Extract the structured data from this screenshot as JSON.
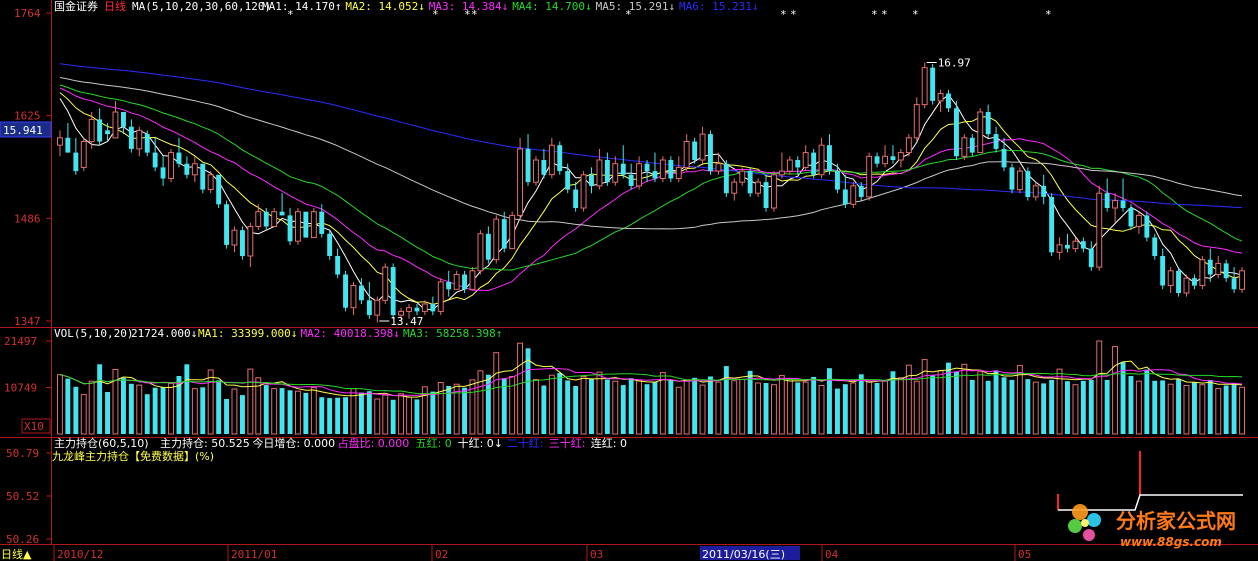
{
  "colors": {
    "background": "#000000",
    "frame": "#b01818",
    "axis_text": "#d23030",
    "up": "#e46d6d",
    "down": "#43e6f0",
    "white": "#ffffff",
    "yellow": "#ffff4c",
    "magenta": "#ff2aff",
    "green": "#27d827",
    "gray": "#c8c8c8",
    "blue": "#2c2cff"
  },
  "header": {
    "stock_name": "国金证券",
    "period": "日线",
    "ma_label": "MA(5,10,20,30,60,120)",
    "ma": [
      {
        "label": "MA1:",
        "value": "14.170",
        "dir": "↑"
      },
      {
        "label": "MA2:",
        "value": "14.052",
        "dir": "↓"
      },
      {
        "label": "MA3:",
        "value": "14.384",
        "dir": "↓"
      },
      {
        "label": "MA4:",
        "value": "14.700",
        "dir": "↓"
      },
      {
        "label": "MA5:",
        "value": "15.291",
        "dir": "↓"
      },
      {
        "label": "MA6:",
        "value": "15.231",
        "dir": "↓"
      }
    ]
  },
  "vol_header": {
    "label": "VOL(5,10,20)",
    "value": "21724.000",
    "dir": "↓",
    "ma": [
      {
        "label": "MA1:",
        "value": "33399.000",
        "dir": "↓"
      },
      {
        "label": "MA2:",
        "value": "40018.398",
        "dir": "↓"
      },
      {
        "label": "MA3:",
        "value": "58258.398",
        "dir": "↑"
      }
    ]
  },
  "ind_header": {
    "label": "主力持仓(60,5,10)",
    "items": [
      {
        "label": "主力持仓:",
        "value": "50.525"
      },
      {
        "label": "今日增仓:",
        "value": "0.000"
      },
      {
        "label": "占盘比:",
        "value": "0.000"
      },
      {
        "label": "五红:",
        "value": "0"
      },
      {
        "label": "十红:",
        "value": "0↓"
      },
      {
        "label": "二十红:",
        "value": ""
      },
      {
        "label": "三十红:",
        "value": ""
      },
      {
        "label": "连红:",
        "value": "0"
      }
    ],
    "subtitle": "九龙峰主力持仓【免费数据】(%)"
  },
  "price_axis": {
    "ticks": [
      "1764",
      "1625",
      "1486",
      "1347"
    ],
    "current": "15.941"
  },
  "vol_axis": {
    "ticks": [
      "21497",
      "10749"
    ],
    "unit": "X10"
  },
  "ind_axis": {
    "ticks": [
      "50.79",
      "50.52",
      "50.26"
    ]
  },
  "date_axis": {
    "period_button": "日线▲",
    "labels": [
      "2010/12",
      "2011/01",
      "02",
      "03",
      "2011/03/16(三)",
      "04",
      "05"
    ]
  },
  "watermark": {
    "text": "分析家公式网",
    "url": "www.88gs.com"
  },
  "chart_data": {
    "type": "candlestick",
    "title": "国金证券 日线",
    "ylim": [
      13.47,
      17.64
    ],
    "annotations": [
      {
        "text": "16.97",
        "type": "high",
        "value": 16.97
      },
      {
        "text": "13.47",
        "type": "low",
        "value": 13.47
      }
    ],
    "candles": [
      [
        15.85,
        16.05,
        15.7,
        15.95
      ],
      [
        15.95,
        16.15,
        15.75,
        15.75
      ],
      [
        15.75,
        15.95,
        15.45,
        15.5
      ],
      [
        15.55,
        15.95,
        15.5,
        15.9
      ],
      [
        15.9,
        16.3,
        15.8,
        16.2
      ],
      [
        16.2,
        16.35,
        15.85,
        15.9
      ],
      [
        16.05,
        16.15,
        15.9,
        16.0
      ],
      [
        15.95,
        16.45,
        15.95,
        16.3
      ],
      [
        16.3,
        16.3,
        16.0,
        16.1
      ],
      [
        16.1,
        16.2,
        15.75,
        15.8
      ],
      [
        15.8,
        16.1,
        15.7,
        16.05
      ],
      [
        16.0,
        16.05,
        15.7,
        15.75
      ],
      [
        15.75,
        15.95,
        15.5,
        15.55
      ],
      [
        15.55,
        15.7,
        15.3,
        15.4
      ],
      [
        15.4,
        15.8,
        15.35,
        15.75
      ],
      [
        15.75,
        15.95,
        15.55,
        15.6
      ],
      [
        15.6,
        15.7,
        15.4,
        15.45
      ],
      [
        15.45,
        15.7,
        15.35,
        15.6
      ],
      [
        15.6,
        15.6,
        15.2,
        15.25
      ],
      [
        15.25,
        15.5,
        15.2,
        15.45
      ],
      [
        15.45,
        15.45,
        15.0,
        15.05
      ],
      [
        15.05,
        15.1,
        14.45,
        14.5
      ],
      [
        14.5,
        14.75,
        14.4,
        14.7
      ],
      [
        14.7,
        14.75,
        14.3,
        14.35
      ],
      [
        14.35,
        14.8,
        14.2,
        14.75
      ],
      [
        14.75,
        15.05,
        14.7,
        14.95
      ],
      [
        14.95,
        15.0,
        14.7,
        14.75
      ],
      [
        14.75,
        15.0,
        14.75,
        14.95
      ],
      [
        14.95,
        15.2,
        14.9,
        14.9
      ],
      [
        14.9,
        15.0,
        14.5,
        14.55
      ],
      [
        14.55,
        15.0,
        14.5,
        14.95
      ],
      [
        14.95,
        14.95,
        14.6,
        14.6
      ],
      [
        14.6,
        15.0,
        14.6,
        14.95
      ],
      [
        14.95,
        15.05,
        14.6,
        14.65
      ],
      [
        14.65,
        14.7,
        14.3,
        14.35
      ],
      [
        14.35,
        14.45,
        14.05,
        14.1
      ],
      [
        14.1,
        14.15,
        13.6,
        13.65
      ],
      [
        13.65,
        14.0,
        13.55,
        13.95
      ],
      [
        13.95,
        14.05,
        13.7,
        13.75
      ],
      [
        13.75,
        14.0,
        13.5,
        13.55
      ],
      [
        13.55,
        13.8,
        13.45,
        13.75
      ],
      [
        13.75,
        14.25,
        13.7,
        14.2
      ],
      [
        14.2,
        14.25,
        13.5,
        13.55
      ],
      [
        13.55,
        13.65,
        13.47,
        13.6
      ],
      [
        13.6,
        13.7,
        13.5,
        13.65
      ],
      [
        13.65,
        13.7,
        13.55,
        13.6
      ],
      [
        13.6,
        13.75,
        13.55,
        13.7
      ],
      [
        13.7,
        13.8,
        13.55,
        13.6
      ],
      [
        13.6,
        14.05,
        13.55,
        14.0
      ],
      [
        14.0,
        14.15,
        13.8,
        13.9
      ],
      [
        13.9,
        14.15,
        13.9,
        14.1
      ],
      [
        14.1,
        14.15,
        13.85,
        13.9
      ],
      [
        13.9,
        14.2,
        13.9,
        14.15
      ],
      [
        14.15,
        14.7,
        14.1,
        14.65
      ],
      [
        14.65,
        14.75,
        14.25,
        14.3
      ],
      [
        14.3,
        14.9,
        14.25,
        14.85
      ],
      [
        14.85,
        14.95,
        14.4,
        14.45
      ],
      [
        14.45,
        14.95,
        14.45,
        14.9
      ],
      [
        14.9,
        15.95,
        14.85,
        15.8
      ],
      [
        15.8,
        16.0,
        15.3,
        15.35
      ],
      [
        15.35,
        15.7,
        15.3,
        15.65
      ],
      [
        15.65,
        15.8,
        15.4,
        15.45
      ],
      [
        15.45,
        15.95,
        15.4,
        15.85
      ],
      [
        15.85,
        15.9,
        15.45,
        15.5
      ],
      [
        15.5,
        15.6,
        15.2,
        15.25
      ],
      [
        15.25,
        15.35,
        14.95,
        15.0
      ],
      [
        15.0,
        15.5,
        14.95,
        15.45
      ],
      [
        15.45,
        15.55,
        15.2,
        15.3
      ],
      [
        15.3,
        15.8,
        15.25,
        15.65
      ],
      [
        15.65,
        15.75,
        15.3,
        15.35
      ],
      [
        15.35,
        15.7,
        15.3,
        15.6
      ],
      [
        15.6,
        15.85,
        15.4,
        15.45
      ],
      [
        15.45,
        15.6,
        15.25,
        15.3
      ],
      [
        15.3,
        15.7,
        15.25,
        15.6
      ],
      [
        15.6,
        15.65,
        15.35,
        15.5
      ],
      [
        15.5,
        15.75,
        15.35,
        15.4
      ],
      [
        15.4,
        15.7,
        15.35,
        15.65
      ],
      [
        15.65,
        15.7,
        15.35,
        15.4
      ],
      [
        15.4,
        15.7,
        15.35,
        15.55
      ],
      [
        15.55,
        16.0,
        15.5,
        15.9
      ],
      [
        15.9,
        15.95,
        15.6,
        15.65
      ],
      [
        15.65,
        16.1,
        15.6,
        16.0
      ],
      [
        16.0,
        16.05,
        15.45,
        15.5
      ],
      [
        15.5,
        15.75,
        15.45,
        15.6
      ],
      [
        15.6,
        15.65,
        15.15,
        15.2
      ],
      [
        15.2,
        15.4,
        15.1,
        15.35
      ],
      [
        15.35,
        15.55,
        15.3,
        15.5
      ],
      [
        15.5,
        15.55,
        15.15,
        15.2
      ],
      [
        15.2,
        15.4,
        15.15,
        15.35
      ],
      [
        15.35,
        15.45,
        14.95,
        15.0
      ],
      [
        15.0,
        15.5,
        14.95,
        15.45
      ],
      [
        15.45,
        15.75,
        15.4,
        15.5
      ],
      [
        15.5,
        15.7,
        15.45,
        15.65
      ],
      [
        15.65,
        15.7,
        15.45,
        15.55
      ],
      [
        15.55,
        15.85,
        15.5,
        15.75
      ],
      [
        15.75,
        15.8,
        15.4,
        15.45
      ],
      [
        15.45,
        15.95,
        15.4,
        15.85
      ],
      [
        15.85,
        16.0,
        15.45,
        15.5
      ],
      [
        15.5,
        15.6,
        15.2,
        15.25
      ],
      [
        15.25,
        15.45,
        15.0,
        15.05
      ],
      [
        15.05,
        15.35,
        15.0,
        15.3
      ],
      [
        15.3,
        15.35,
        15.1,
        15.15
      ],
      [
        15.15,
        15.75,
        15.1,
        15.7
      ],
      [
        15.7,
        15.75,
        15.55,
        15.6
      ],
      [
        15.6,
        15.85,
        15.55,
        15.7
      ],
      [
        15.7,
        15.85,
        15.6,
        15.65
      ],
      [
        15.65,
        15.8,
        15.55,
        15.75
      ],
      [
        15.75,
        16.0,
        15.7,
        15.95
      ],
      [
        15.95,
        16.5,
        15.9,
        16.4
      ],
      [
        16.4,
        16.97,
        16.35,
        16.9
      ],
      [
        16.9,
        16.95,
        16.4,
        16.45
      ],
      [
        16.45,
        16.6,
        16.3,
        16.55
      ],
      [
        16.55,
        16.6,
        16.3,
        16.35
      ],
      [
        16.35,
        16.45,
        15.65,
        15.7
      ],
      [
        15.7,
        16.0,
        15.65,
        15.95
      ],
      [
        15.95,
        16.0,
        15.7,
        15.75
      ],
      [
        15.75,
        16.35,
        15.75,
        16.3
      ],
      [
        16.3,
        16.4,
        15.95,
        16.0
      ],
      [
        16.0,
        16.1,
        15.75,
        15.8
      ],
      [
        15.8,
        15.95,
        15.5,
        15.55
      ],
      [
        15.55,
        15.6,
        15.2,
        15.25
      ],
      [
        15.25,
        15.55,
        15.2,
        15.5
      ],
      [
        15.5,
        15.55,
        15.1,
        15.15
      ],
      [
        15.15,
        15.35,
        15.1,
        15.3
      ],
      [
        15.3,
        15.45,
        15.05,
        15.15
      ],
      [
        15.15,
        15.2,
        14.35,
        14.4
      ],
      [
        14.4,
        14.6,
        14.3,
        14.5
      ],
      [
        14.5,
        14.65,
        14.4,
        14.45
      ],
      [
        14.45,
        14.6,
        14.4,
        14.55
      ],
      [
        14.55,
        14.6,
        14.4,
        14.45
      ],
      [
        14.45,
        14.55,
        14.15,
        14.2
      ],
      [
        14.2,
        15.3,
        14.15,
        15.2
      ],
      [
        15.2,
        15.4,
        14.95,
        15.0
      ],
      [
        15.0,
        15.2,
        14.8,
        15.1
      ],
      [
        15.1,
        15.4,
        14.95,
        15.0
      ],
      [
        15.0,
        15.05,
        14.7,
        14.75
      ],
      [
        14.75,
        14.95,
        14.65,
        14.9
      ],
      [
        14.9,
        14.95,
        14.55,
        14.6
      ],
      [
        14.6,
        14.65,
        14.3,
        14.35
      ],
      [
        14.35,
        14.45,
        13.9,
        13.95
      ],
      [
        13.95,
        14.2,
        13.85,
        14.15
      ],
      [
        14.15,
        14.2,
        13.8,
        13.85
      ],
      [
        13.85,
        14.1,
        13.8,
        14.05
      ],
      [
        14.05,
        14.1,
        13.9,
        13.95
      ],
      [
        13.95,
        14.35,
        13.9,
        14.3
      ],
      [
        14.3,
        14.45,
        14.0,
        14.1
      ],
      [
        14.1,
        14.35,
        14.05,
        14.25
      ],
      [
        14.25,
        14.3,
        14.0,
        14.05
      ],
      [
        14.05,
        14.2,
        13.85,
        13.9
      ],
      [
        13.9,
        14.2,
        13.85,
        14.15
      ]
    ],
    "volume": [
      13700,
      12800,
      10900,
      9100,
      12200,
      16100,
      9700,
      14900,
      13000,
      11600,
      11300,
      9200,
      10700,
      10900,
      11700,
      13400,
      16100,
      10500,
      10800,
      14800,
      12400,
      8100,
      10400,
      9000,
      15000,
      13000,
      11300,
      10500,
      10600,
      10100,
      9900,
      9500,
      10700,
      8500,
      8300,
      8400,
      8500,
      10500,
      9600,
      9900,
      8100,
      9000,
      7900,
      9300,
      8500,
      8000,
      10900,
      9800,
      11900,
      11100,
      11500,
      10700,
      12500,
      14600,
      13700,
      18800,
      12900,
      13300,
      21000,
      19800,
      12600,
      11200,
      13600,
      14100,
      12400,
      11100,
      13300,
      12800,
      14300,
      12600,
      12200,
      11300,
      12900,
      12300,
      11500,
      12000,
      14200,
      12400,
      10800,
      12500,
      13000,
      11300,
      13300,
      12000,
      15700,
      12300,
      12600,
      14600,
      11800,
      11800,
      11400,
      13500,
      12800,
      11900,
      12000,
      13200,
      11200,
      15200,
      10500,
      11500,
      11800,
      13800,
      12100,
      11800,
      12200,
      14500,
      13000,
      15900,
      12200,
      17200,
      13500,
      14600,
      16500,
      14400,
      16100,
      12500,
      14400,
      12300,
      14700,
      13100,
      12500,
      15800,
      12700,
      12000,
      11700,
      12500,
      15000,
      12200,
      11400,
      12300,
      12500,
      21497,
      12500,
      20200,
      16600,
      13400,
      12200,
      14900,
      12300,
      12400,
      11500,
      12700,
      11200,
      12000,
      11400,
      12500,
      10500,
      11200,
      11800,
      10800
    ],
    "ma_series": [
      {
        "name": "MA1",
        "color": "white",
        "period": 5
      },
      {
        "name": "MA2",
        "color": "yellow",
        "period": 10
      },
      {
        "name": "MA3",
        "color": "magenta",
        "period": 20
      },
      {
        "name": "MA4",
        "color": "green",
        "period": 30
      },
      {
        "name": "MA5",
        "color": "gray",
        "period": 60
      },
      {
        "name": "MA6",
        "color": "blue",
        "period": 120
      }
    ]
  }
}
